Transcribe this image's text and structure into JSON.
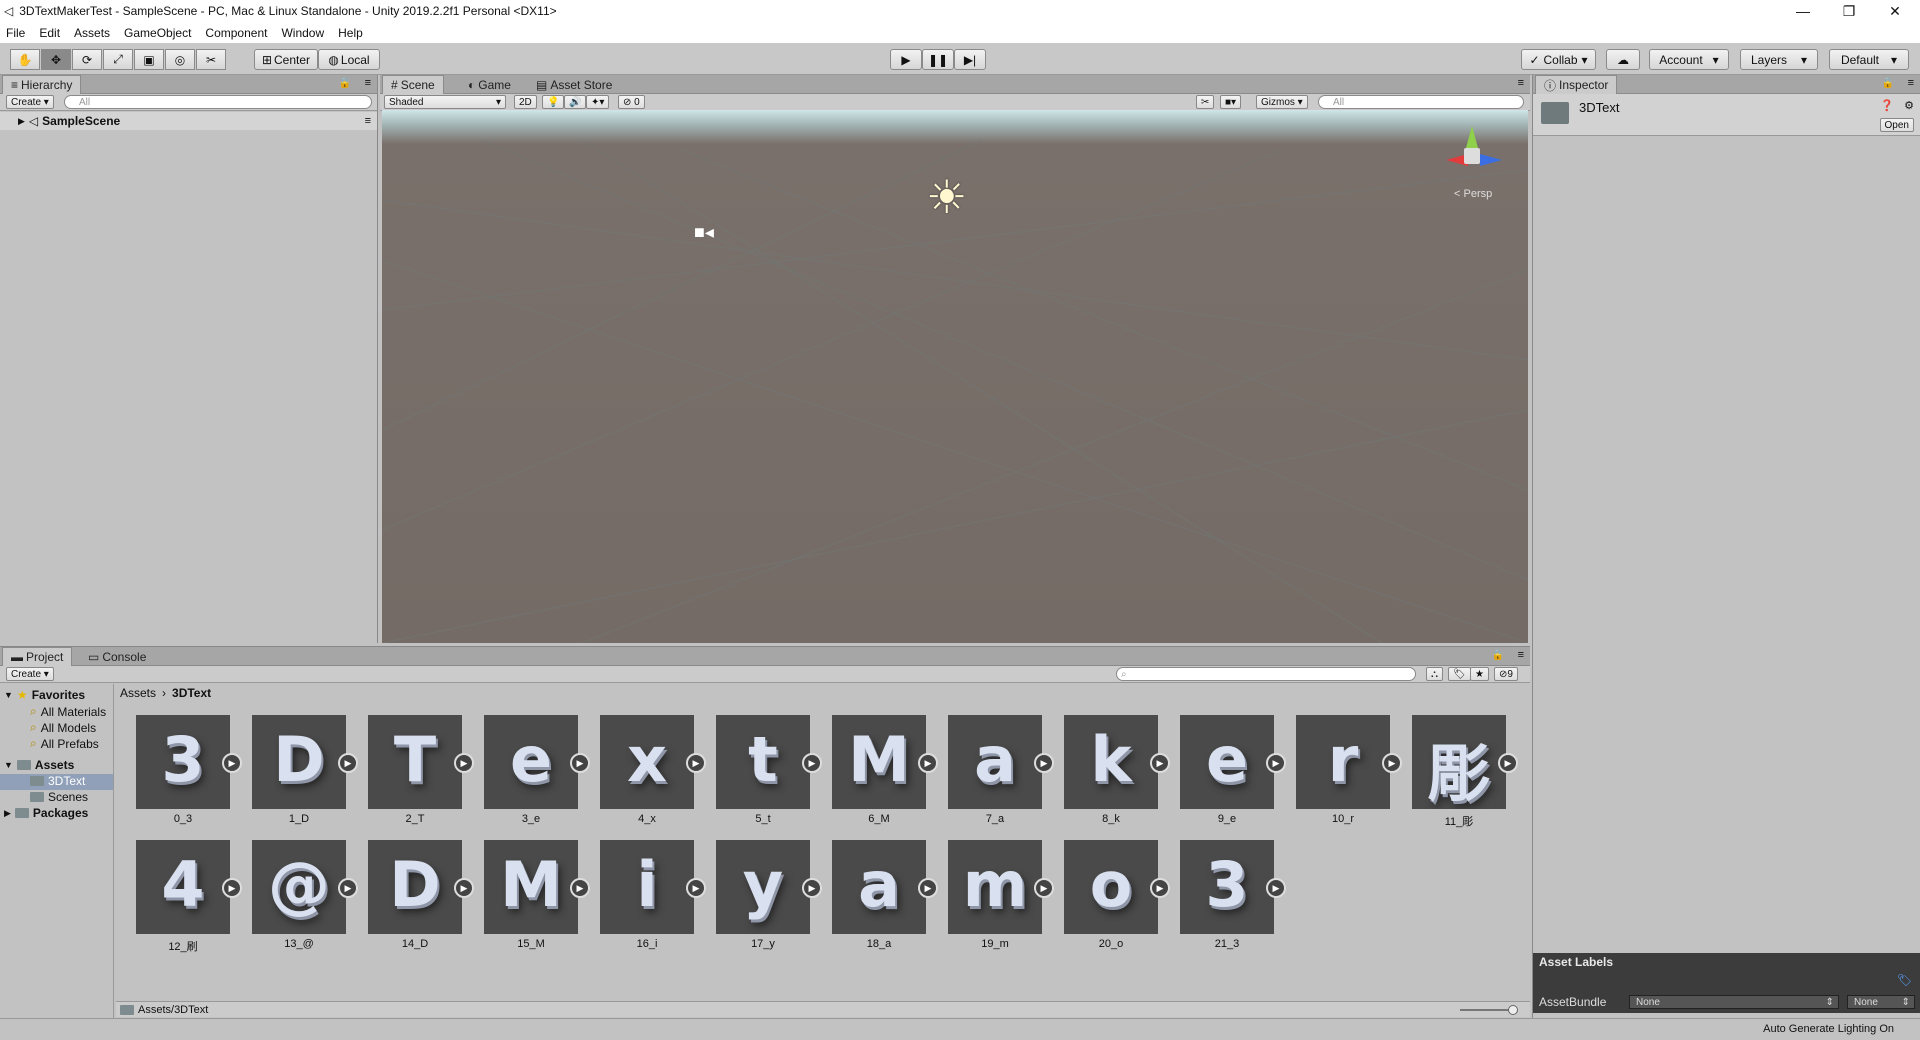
{
  "window": {
    "title": "3DTextMakerTest - SampleScene - PC, Mac & Linux Standalone - Unity 2019.2.2f1 Personal <DX11>",
    "minimize": "—",
    "restore": "❐",
    "close": "✕"
  },
  "menu": [
    "File",
    "Edit",
    "Assets",
    "GameObject",
    "Component",
    "Window",
    "Help"
  ],
  "toolbar": {
    "center": "Center",
    "local": "Local",
    "collab": "Collab",
    "account": "Account",
    "layers": "Layers",
    "layout": "Default"
  },
  "hierarchy": {
    "tab": "Hierarchy",
    "create": "Create",
    "search": "All",
    "scene": "SampleScene"
  },
  "scene": {
    "tabs": [
      "Scene",
      "Game",
      "Asset Store"
    ],
    "shading": "Shaded",
    "mode2d": "2D",
    "count": "0",
    "gizmos": "Gizmos",
    "search": "All",
    "persp": "Persp"
  },
  "inspector": {
    "tab": "Inspector",
    "object": "3DText",
    "open": "Open",
    "asset_labels": "Asset Labels",
    "assetbundle": "AssetBundle",
    "none1": "None",
    "none2": "None"
  },
  "project": {
    "tabs": [
      "Project",
      "Console"
    ],
    "create": "Create",
    "count": "9",
    "breadcrumb": [
      "Assets",
      "3DText"
    ],
    "path": "Assets/3DText",
    "favorites": "Favorites",
    "fav_items": [
      "All Materials",
      "All Models",
      "All Prefabs"
    ],
    "assets_label": "Assets",
    "asset_children": [
      "3DText",
      "Scenes"
    ],
    "packages": "Packages",
    "items": [
      {
        "glyph": "3",
        "name": "0_3"
      },
      {
        "glyph": "D",
        "name": "1_D"
      },
      {
        "glyph": "T",
        "name": "2_T"
      },
      {
        "glyph": "e",
        "name": "3_e"
      },
      {
        "glyph": "x",
        "name": "4_x"
      },
      {
        "glyph": "t",
        "name": "5_t"
      },
      {
        "glyph": "M",
        "name": "6_M"
      },
      {
        "glyph": "a",
        "name": "7_a"
      },
      {
        "glyph": "k",
        "name": "8_k"
      },
      {
        "glyph": "e",
        "name": "9_e"
      },
      {
        "glyph": "r",
        "name": "10_r"
      },
      {
        "glyph": "彫",
        "name": "11_彫"
      },
      {
        "glyph": "4",
        "name": "12_刷"
      },
      {
        "glyph": "@",
        "name": "13_@"
      },
      {
        "glyph": "D",
        "name": "14_D"
      },
      {
        "glyph": "M",
        "name": "15_M"
      },
      {
        "glyph": "i",
        "name": "16_i"
      },
      {
        "glyph": "y",
        "name": "17_y"
      },
      {
        "glyph": "a",
        "name": "18_a"
      },
      {
        "glyph": "m",
        "name": "19_m"
      },
      {
        "glyph": "o",
        "name": "20_o"
      },
      {
        "glyph": "3",
        "name": "21_3"
      }
    ]
  },
  "status": {
    "right": "Auto Generate Lighting On"
  }
}
